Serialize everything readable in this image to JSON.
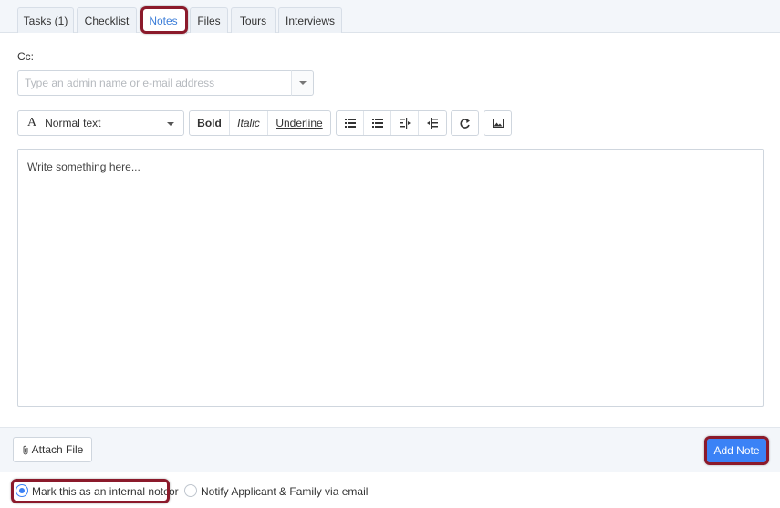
{
  "tabs": [
    {
      "label": "Tasks (1)",
      "active": false
    },
    {
      "label": "Checklist",
      "active": false
    },
    {
      "label": "Notes",
      "active": true
    },
    {
      "label": "Files",
      "active": false
    },
    {
      "label": "Tours",
      "active": false
    },
    {
      "label": "Interviews",
      "active": false
    }
  ],
  "cc": {
    "label": "Cc:",
    "placeholder": "Type an admin name or e-mail address",
    "value": ""
  },
  "toolbar": {
    "text_style": "Normal text",
    "bold": "Bold",
    "italic": "Italic",
    "underline": "Underline",
    "list_icons": [
      "unordered-list-icon",
      "ordered-list-icon",
      "outdent-icon",
      "indent-icon"
    ],
    "redo_icon": "redo-icon",
    "image_icon": "image-icon"
  },
  "editor": {
    "placeholder": "Write something here..."
  },
  "footer": {
    "attach_label": "Attach File",
    "add_note_label": "Add Note"
  },
  "visibility": {
    "internal_label": "Mark this as an internal note",
    "or_text": "or",
    "notify_label": "Notify Applicant & Family via email",
    "selected": "internal"
  },
  "colors": {
    "accent": "#3b82f6",
    "active_tab_text": "#3b7dd8",
    "highlight_border": "#8b1a2b"
  }
}
